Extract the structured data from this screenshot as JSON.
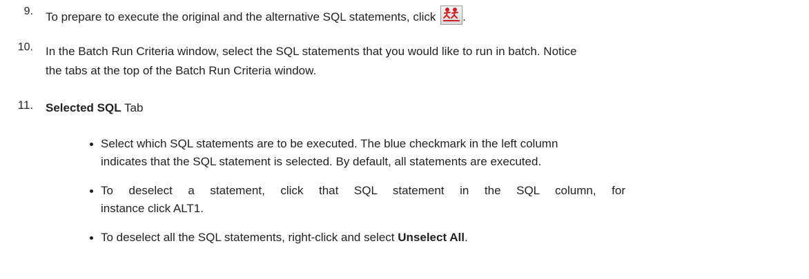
{
  "steps": [
    {
      "number": "9.",
      "text": "To prepare to execute the original and the alternative SQL statements, click",
      "trailing": ".",
      "icon": "batch-run-icon"
    },
    {
      "number": "10.",
      "line1": "In the Batch Run Criteria window, select the SQL statements that you would like to run in batch. Notice",
      "line2": "the tabs at the top of the Batch Run Criteria window."
    },
    {
      "number": "11.",
      "bold": "Selected SQL",
      "rest": " Tab",
      "bullets": [
        {
          "line1": "Select which SQL statements are to be executed. The blue checkmark in the left column",
          "line2": "indicates that the SQL statement is selected. By default, all statements are executed."
        },
        {
          "line1": "To deselect a statement, click that SQL statement in the SQL column, for",
          "line2": "instance click ALT1."
        },
        {
          "text": "To deselect all the SQL statements, right-click and select ",
          "bold": "Unselect All",
          "trailing": "."
        }
      ]
    }
  ],
  "icon_colors": {
    "figure": "#d42020",
    "bar": "#d42020"
  }
}
